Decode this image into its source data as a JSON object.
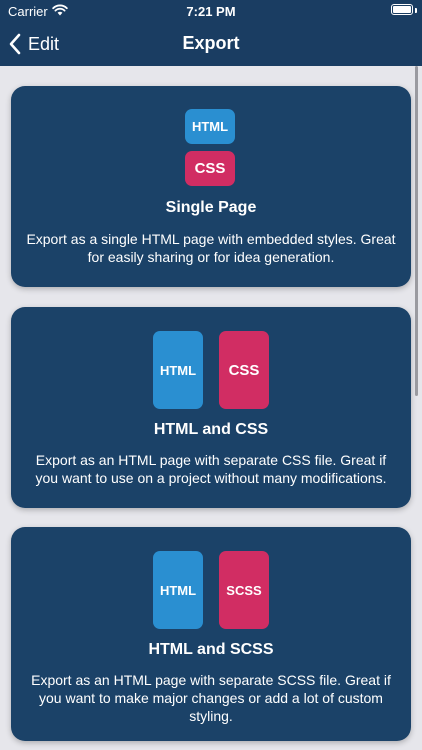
{
  "status_bar": {
    "carrier": "Carrier",
    "time": "7:21 PM"
  },
  "nav": {
    "back_label": "Edit",
    "title": "Export"
  },
  "options": [
    {
      "title": "Single Page",
      "tiles": [
        "HTML",
        "CSS"
      ],
      "description": "Export as a single HTML page with embedded styles. Great for easily sharing or for idea generation."
    },
    {
      "title": "HTML and CSS",
      "tiles": [
        "HTML",
        "CSS"
      ],
      "description": "Export as an HTML page with separate CSS file. Great if you want to use on a project without many modifications."
    },
    {
      "title": "HTML and SCSS",
      "tiles": [
        "HTML",
        "SCSS"
      ],
      "description": "Export as an HTML page with separate SCSS file. Great if you want to make major changes or add a lot of custom styling."
    }
  ],
  "colors": {
    "header": "#1a3d62",
    "card": "#1b4268",
    "html_tile": "#2a8fd1",
    "css_tile": "#d12d63",
    "background": "#e6e6eb"
  }
}
